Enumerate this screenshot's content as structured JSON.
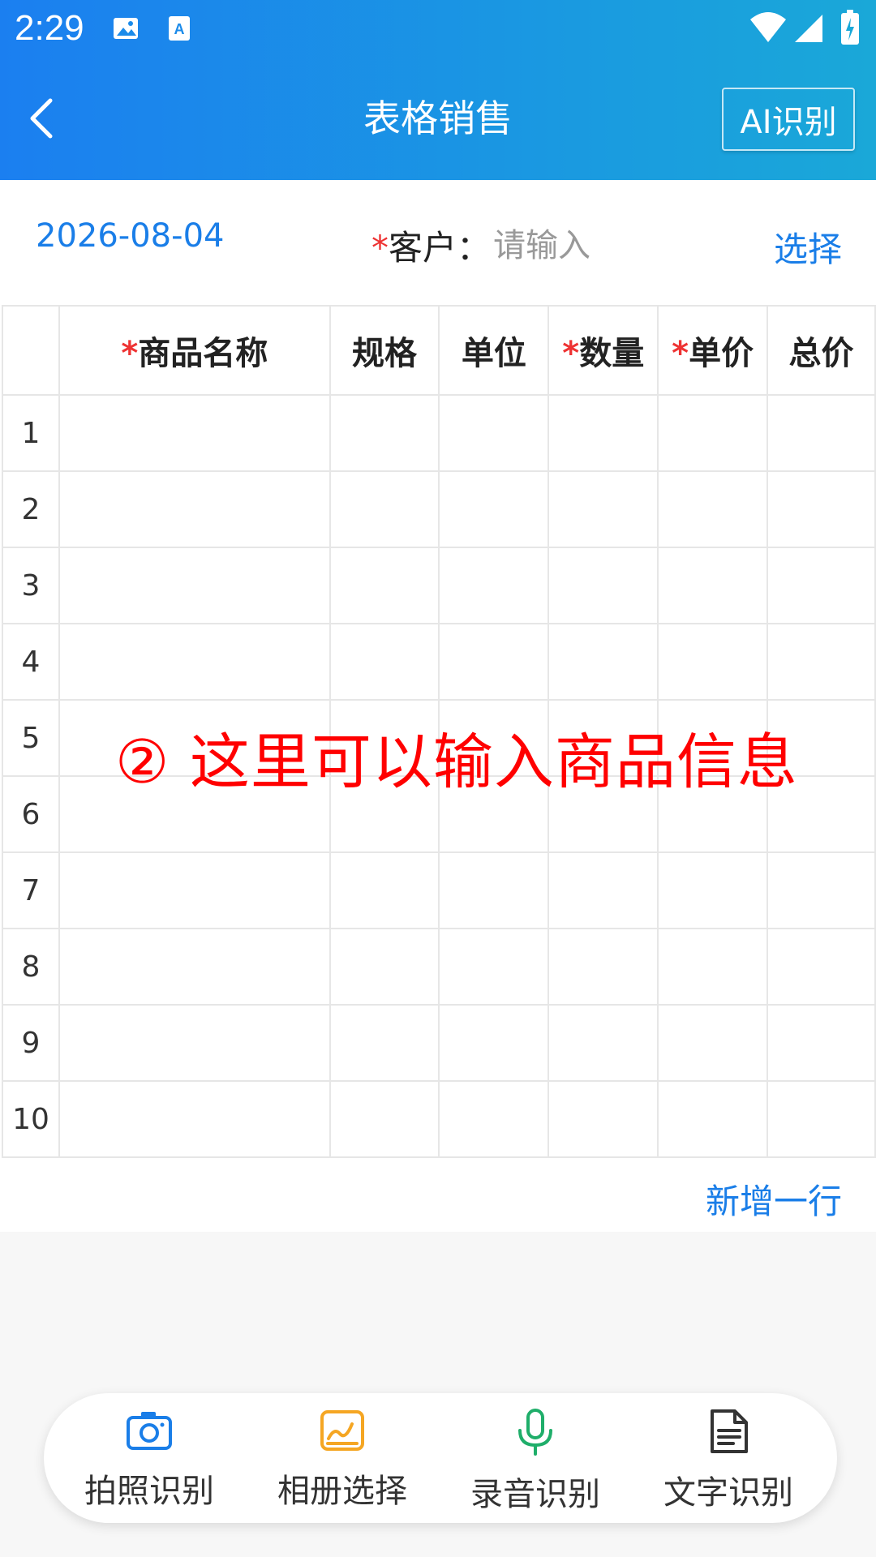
{
  "status": {
    "time": "2:29"
  },
  "nav": {
    "title": "表格销售",
    "ai_button": "AI识别"
  },
  "form": {
    "date": "2026-08-04",
    "required_mark": "*",
    "customer_label": "客户：",
    "customer_placeholder": "请输入",
    "select_label": "选择"
  },
  "table": {
    "headers": [
      {
        "label": "",
        "required": false
      },
      {
        "label": "商品名称",
        "required": true
      },
      {
        "label": "规格",
        "required": false
      },
      {
        "label": "单位",
        "required": false
      },
      {
        "label": "数量",
        "required": true
      },
      {
        "label": "单价",
        "required": true
      },
      {
        "label": "总价",
        "required": false
      }
    ],
    "rows": [
      "1",
      "2",
      "3",
      "4",
      "5",
      "6",
      "7",
      "8",
      "9",
      "10"
    ]
  },
  "overlay_note": "② 这里可以输入商品信息",
  "add_row_label": "新增一行",
  "toolbar": {
    "items": [
      {
        "label": "拍照识别",
        "icon": "camera-icon",
        "color": "#1a7ee8"
      },
      {
        "label": "相册选择",
        "icon": "gallery-icon",
        "color": "#f5a623"
      },
      {
        "label": "录音识别",
        "icon": "microphone-icon",
        "color": "#1fae6a"
      },
      {
        "label": "文字识别",
        "icon": "document-icon",
        "color": "#333333"
      }
    ]
  },
  "colors": {
    "accent": "#1a7ee8",
    "required": "#ee3333",
    "annotation": "#ff0000"
  }
}
